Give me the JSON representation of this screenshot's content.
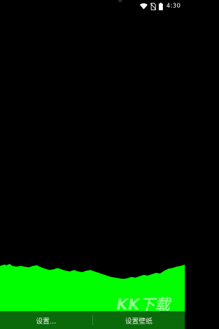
{
  "status_bar": {
    "time": "4:30",
    "icons": [
      "wifi-icon",
      "no-sim-icon",
      "battery-icon"
    ]
  },
  "wallpaper": {
    "wave_color": "#00ff00",
    "background_color": "#000000"
  },
  "bottom_bar": {
    "settings_label": "设置...",
    "set_wallpaper_label": "设置壁纸",
    "background_color": "#0a6a0a"
  },
  "watermark": {
    "text": "KK下载"
  }
}
